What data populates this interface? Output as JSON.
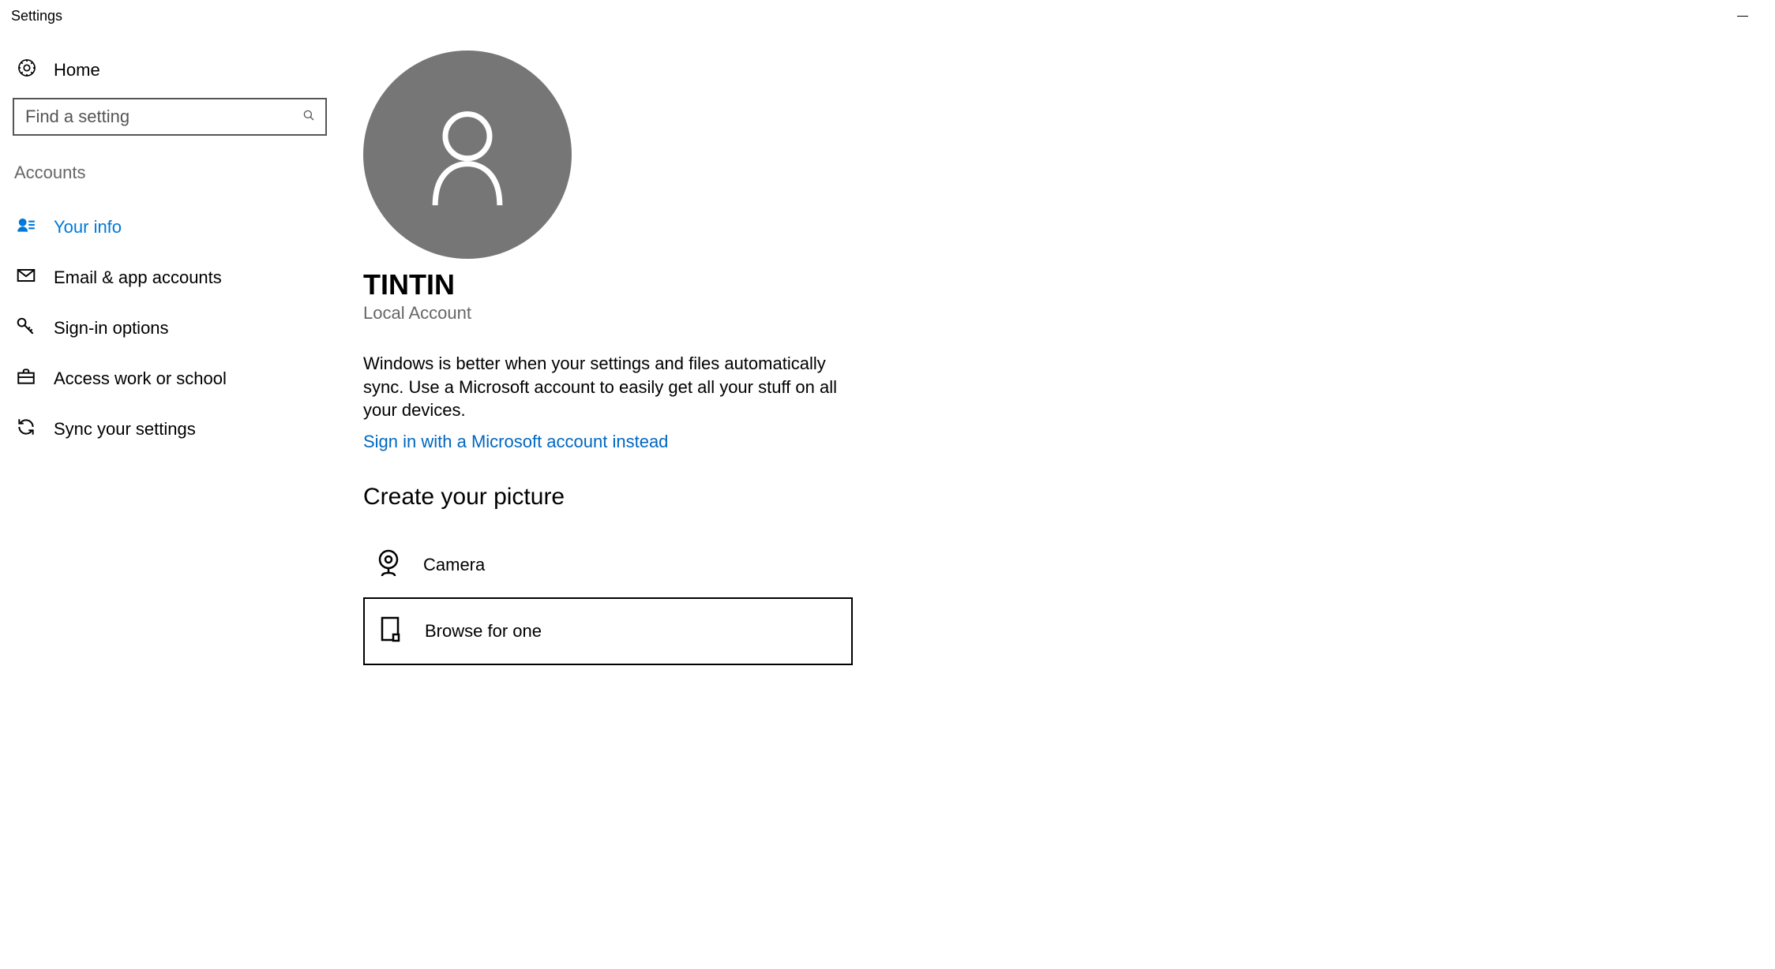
{
  "titlebar": {
    "title": "Settings"
  },
  "sidebar": {
    "home_label": "Home",
    "search_placeholder": "Find a setting",
    "section_label": "Accounts",
    "items": [
      {
        "label": "Your info"
      },
      {
        "label": "Email & app accounts"
      },
      {
        "label": "Sign-in options"
      },
      {
        "label": "Access work or school"
      },
      {
        "label": "Sync your settings"
      }
    ]
  },
  "main": {
    "username": "TINTIN",
    "account_type": "Local Account",
    "sync_text": "Windows is better when your settings and files automatically sync. Use a Microsoft account to easily get all your stuff on all your devices.",
    "signin_link": "Sign in with a Microsoft account instead",
    "create_picture_heading": "Create your picture",
    "picture_options": {
      "camera": "Camera",
      "browse": "Browse for one"
    }
  }
}
